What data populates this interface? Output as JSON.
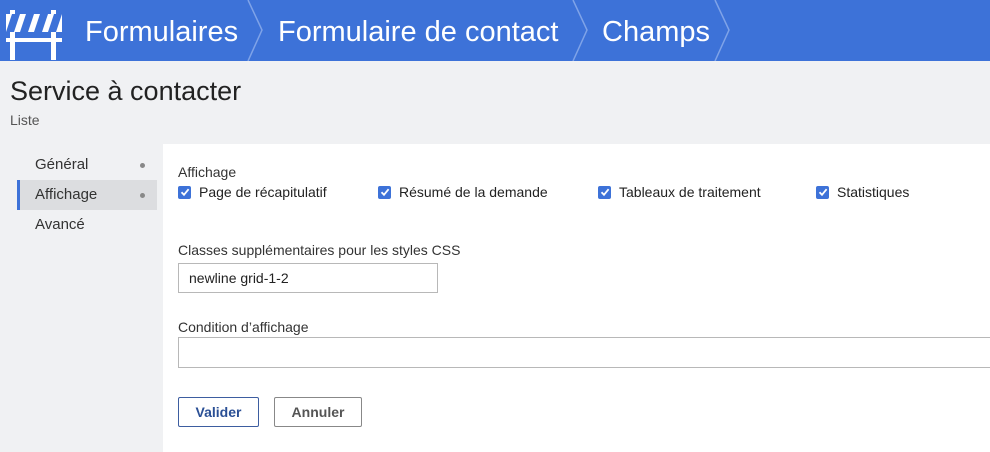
{
  "breadcrumb": {
    "items": [
      {
        "label": "Formulaires"
      },
      {
        "label": "Formulaire de contact"
      },
      {
        "label": "Champs"
      }
    ]
  },
  "header": {
    "title": "Service à contacter",
    "subtitle": "Liste"
  },
  "nav": {
    "items": [
      {
        "label": "Général"
      },
      {
        "label": "Affichage"
      },
      {
        "label": "Avancé"
      }
    ]
  },
  "form": {
    "display": {
      "label": "Affichage",
      "options": [
        {
          "label": "Page de récapitulatif",
          "checked": true
        },
        {
          "label": "Résumé de la demande",
          "checked": true
        },
        {
          "label": "Tableaux de traitement",
          "checked": true
        },
        {
          "label": "Statistiques",
          "checked": true
        }
      ]
    },
    "css_classes": {
      "label": "Classes supplémentaires pour les styles CSS",
      "value": "newline grid-1-2"
    },
    "condition": {
      "label": "Condition d’affichage",
      "value": ""
    },
    "buttons": {
      "submit": "Valider",
      "cancel": "Annuler"
    }
  },
  "colors": {
    "accent": "#3d72d8",
    "background": "#f0f1f3"
  }
}
